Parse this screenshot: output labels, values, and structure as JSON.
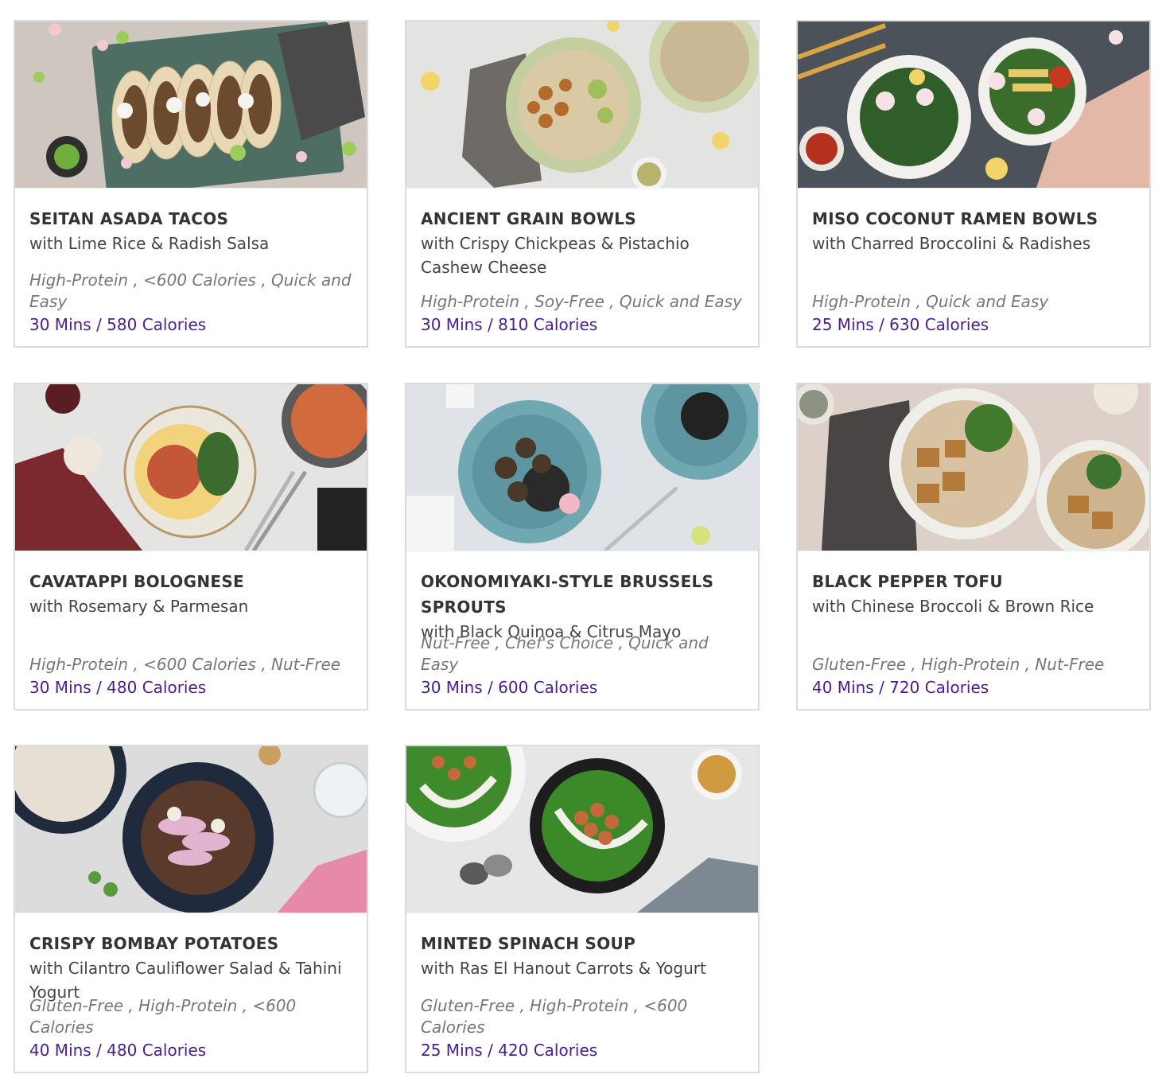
{
  "recipes": [
    {
      "title": "SEITAN ASADA TACOS",
      "subtitle": "with Lime Rice & Radish Salsa",
      "tags": "High-Protein , <600 Calories , Quick and Easy",
      "meta": "30 Mins / 580 Calories"
    },
    {
      "title": "ANCIENT GRAIN BOWLS",
      "subtitle": "with Crispy Chickpeas & Pistachio Cashew Cheese",
      "tags": "High-Protein , Soy-Free , Quick and Easy",
      "meta": "30 Mins / 810 Calories"
    },
    {
      "title": "MISO COCONUT RAMEN BOWLS",
      "subtitle": "with Charred Broccolini & Radishes",
      "tags": "High-Protein , Quick and Easy",
      "meta": "25 Mins / 630 Calories"
    },
    {
      "title": "CAVATAPPI BOLOGNESE",
      "subtitle": "with Rosemary & Parmesan",
      "tags": "High-Protein , <600 Calories , Nut-Free",
      "meta": "30 Mins / 480 Calories"
    },
    {
      "title": "OKONOMIYAKI-STYLE BRUSSELS SPROUTS",
      "subtitle": "with Black Quinoa & Citrus Mayo",
      "tags": "Nut-Free , Chef's Choice , Quick and Easy",
      "meta": "30 Mins / 600 Calories"
    },
    {
      "title": "BLACK PEPPER TOFU",
      "subtitle": "with Chinese Broccoli & Brown Rice",
      "tags": "Gluten-Free , High-Protein , Nut-Free",
      "meta": "40 Mins / 720 Calories"
    },
    {
      "title": "CRISPY BOMBAY POTATOES",
      "subtitle": "with Cilantro Cauliflower Salad & Tahini Yogurt",
      "tags": "Gluten-Free , High-Protein , <600 Calories",
      "meta": "40 Mins / 480 Calories"
    },
    {
      "title": "MINTED SPINACH SOUP",
      "subtitle": "with Ras El Hanout Carrots & Yogurt",
      "tags": "Gluten-Free , High-Protein , <600 Calories",
      "meta": "25 Mins / 420 Calories"
    }
  ],
  "colors": {
    "meta": "#4a1d8c",
    "border": "#dcdcdc"
  }
}
